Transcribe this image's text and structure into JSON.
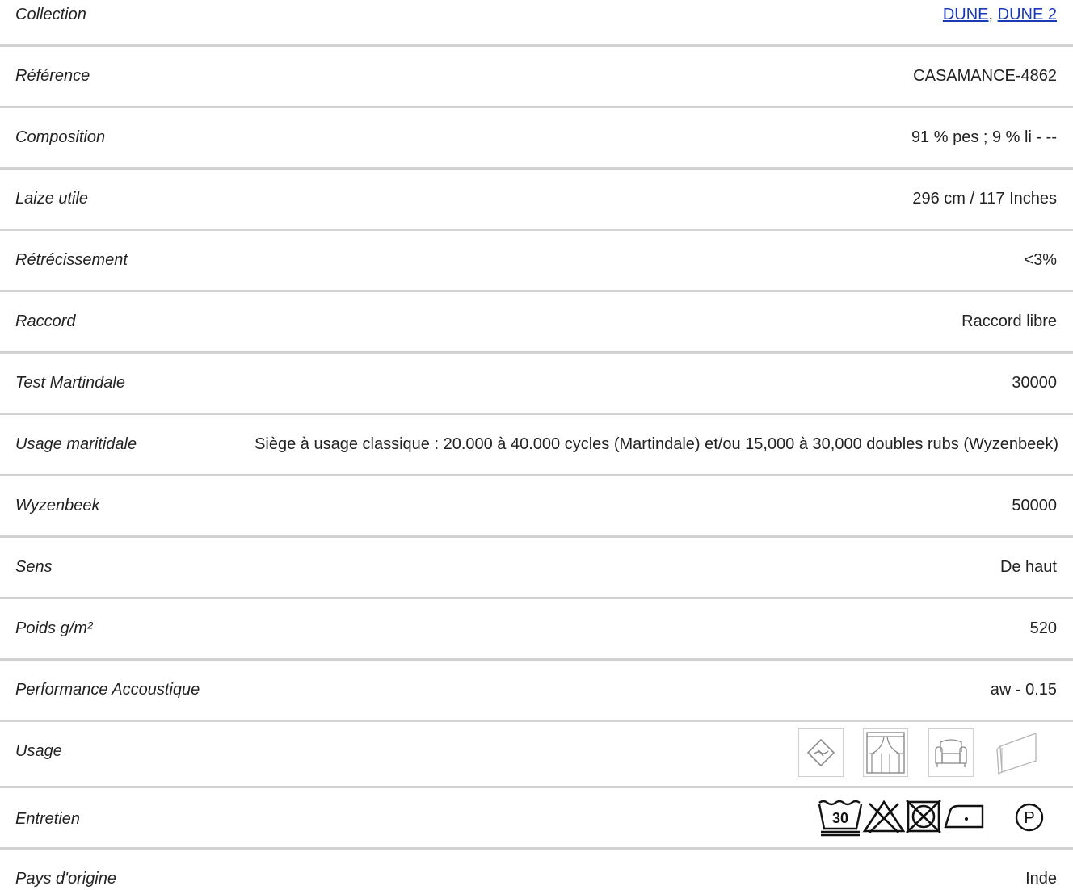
{
  "colors": {
    "text": "#222222",
    "link": "#1a39b6",
    "divider": "#d2d2d2",
    "icon_stroke": "#8a8a8a",
    "care_stroke": "#111111"
  },
  "rows": [
    {
      "label": "Collection",
      "links": [
        "DUNE",
        "DUNE 2"
      ],
      "separator": ", "
    },
    {
      "label": "Référence",
      "value": "CASAMANCE-4862"
    },
    {
      "label": "Composition",
      "value": "91 % pes ; 9 % li - --"
    },
    {
      "label": "Laize utile",
      "value": "296 cm / 117 Inches"
    },
    {
      "label": "Rétrécissement",
      "value": "<3%"
    },
    {
      "label": "Raccord",
      "value": "Raccord libre"
    },
    {
      "label": "Test Martindale",
      "value": "30000"
    },
    {
      "label": "Usage maritidale",
      "value": "Siège à usage classique : 20.000 à 40.000 cycles (Martindale) et/ou 15,000 à 30,000 doubles rubs (Wyzenbeek)"
    },
    {
      "label": "Wyzenbeek",
      "value": "50000"
    },
    {
      "label": "Sens",
      "value": "De haut"
    },
    {
      "label": "Poids g/m²",
      "value": "520"
    },
    {
      "label": "Performance Accoustique",
      "value": "aw - 0.15"
    },
    {
      "label": "Usage",
      "icons": [
        "flame-retardant-icon",
        "curtain-icon",
        "armchair-icon",
        "wall-covering-icon"
      ]
    },
    {
      "label": "Entretien",
      "care_icons": [
        "wash-30-icon",
        "no-bleach-icon",
        "no-tumble-dry-icon",
        "iron-low-icon",
        "dry-clean-p-icon"
      ],
      "wash_temp": "30",
      "dry_clean_letter": "P"
    },
    {
      "label": "Pays d'origine",
      "value": "Inde"
    }
  ]
}
